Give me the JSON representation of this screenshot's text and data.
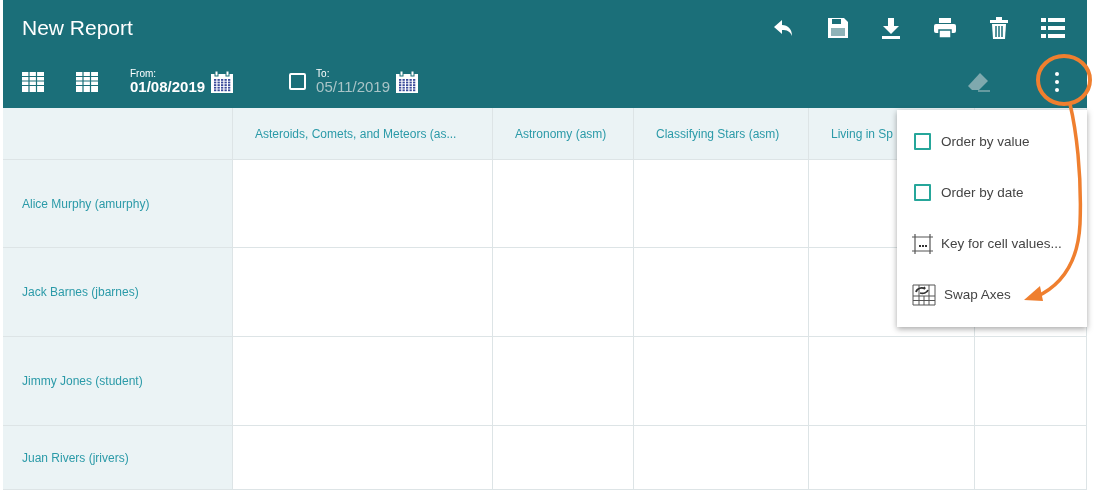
{
  "header": {
    "title": "New Report",
    "from": {
      "label": "From:",
      "value": "01/08/2019"
    },
    "to": {
      "label": "To:",
      "value": "05/11/2019",
      "checked": false
    }
  },
  "table": {
    "columns": [
      "Asteroids, Comets, and Meteors (as...",
      "Astronomy (asm)",
      "Classifying Stars (asm)",
      "Living in Sp"
    ],
    "rows": [
      "Alice Murphy (amurphy)",
      "Jack Barnes (jbarnes)",
      "Jimmy Jones (student)",
      "Juan Rivers (jrivers)"
    ]
  },
  "menu": {
    "items": [
      {
        "kind": "checkbox",
        "label": "Order by value",
        "checked": false
      },
      {
        "kind": "checkbox",
        "label": "Order by date",
        "checked": false
      },
      {
        "kind": "key",
        "label": "Key for cell values..."
      },
      {
        "kind": "swap",
        "label": "Swap Axes"
      }
    ]
  }
}
